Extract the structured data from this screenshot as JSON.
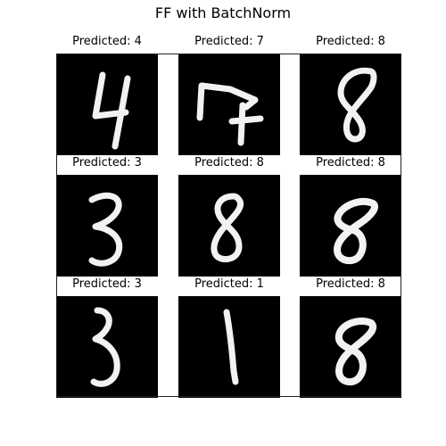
{
  "figure": {
    "title": "FF with BatchNorm"
  },
  "grid": [
    {
      "label": "Predicted: 4",
      "digit": "4"
    },
    {
      "label": "Predicted: 7",
      "digit": "7"
    },
    {
      "label": "Predicted: 8",
      "digit": "8"
    },
    {
      "label": "Predicted: 3",
      "digit": "3"
    },
    {
      "label": "Predicted: 8",
      "digit": "8"
    },
    {
      "label": "Predicted: 8",
      "digit": "8"
    },
    {
      "label": "Predicted: 3",
      "digit": "3"
    },
    {
      "label": "Predicted: 1",
      "digit": "1"
    },
    {
      "label": "Predicted: 8",
      "digit": "8"
    }
  ],
  "colors": {
    "background": "#ffffff",
    "image_bg": "#000000",
    "stroke": "#f2f2f2"
  }
}
